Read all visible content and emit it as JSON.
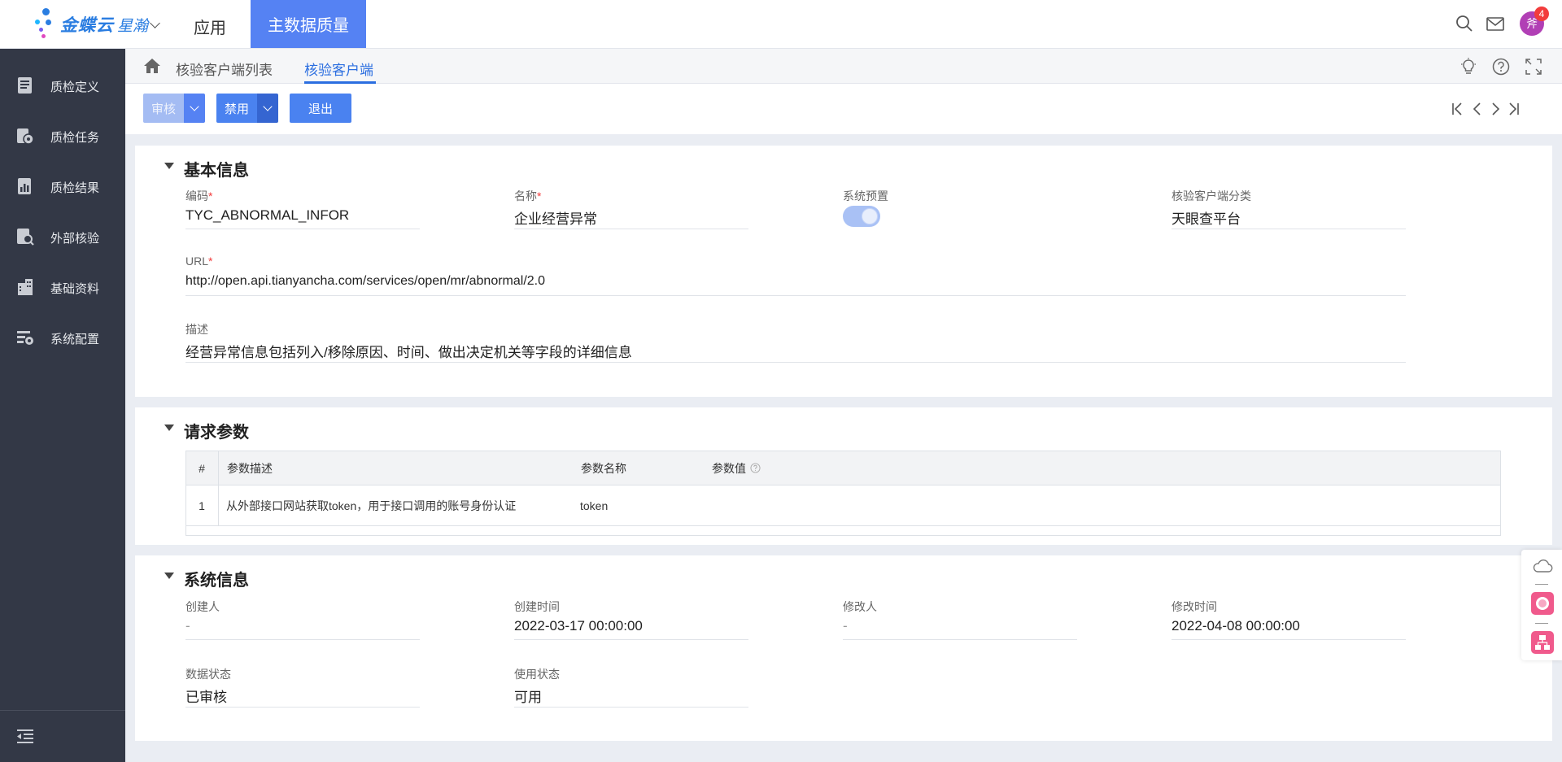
{
  "header": {
    "logo_text": "金蝶云",
    "logo_sub": "星瀚",
    "nav_app": "应用",
    "nav_active": "主数据质量",
    "notification_count": "4",
    "avatar_text": "斧"
  },
  "sidebar": {
    "items": [
      {
        "label": "质检定义",
        "icon": "book-icon"
      },
      {
        "label": "质检任务",
        "icon": "task-gear-icon"
      },
      {
        "label": "质检结果",
        "icon": "report-chart-icon"
      },
      {
        "label": "外部核验",
        "icon": "search-document-icon"
      },
      {
        "label": "基础资料",
        "icon": "building-icon"
      },
      {
        "label": "系统配置",
        "icon": "settings-list-icon"
      }
    ]
  },
  "breadcrumb": {
    "list": "核验客户端列表",
    "current": "核验客户端"
  },
  "toolbar": {
    "audit": "审核",
    "disable": "禁用",
    "exit": "退出"
  },
  "basic_info": {
    "title": "基本信息",
    "code_label": "编码",
    "code_value": "TYC_ABNORMAL_INFOR",
    "name_label": "名称",
    "name_value": "企业经营异常",
    "preset_label": "系统预置",
    "preset_on": true,
    "category_label": "核验客户端分类",
    "category_value": "天眼查平台",
    "url_label": "URL",
    "url_value": "http://open.api.tianyancha.com/services/open/mr/abnormal/2.0",
    "desc_label": "描述",
    "desc_value": "经营异常信息包括列入/移除原因、时间、做出决定机关等字段的详细信息"
  },
  "request_params": {
    "title": "请求参数",
    "columns": {
      "index": "#",
      "desc": "参数描述",
      "name": "参数名称",
      "value": "参数值"
    },
    "rows": [
      {
        "index": "1",
        "desc": "从外部接口网站获取token，用于接口调用的账号身份认证",
        "name": "token",
        "value": ""
      }
    ]
  },
  "system_info": {
    "title": "系统信息",
    "creator_label": "创建人",
    "creator_value": "-",
    "created_label": "创建时间",
    "created_value": "2022-03-17 00:00:00",
    "modifier_label": "修改人",
    "modifier_value": "-",
    "modified_label": "修改时间",
    "modified_value": "2022-04-08 00:00:00",
    "data_status_label": "数据状态",
    "data_status_value": "已审核",
    "use_status_label": "使用状态",
    "use_status_value": "可用"
  },
  "colors": {
    "primary": "#5582f3",
    "sidebar": "#333846",
    "link": "#2b6ee0",
    "required": "#f23c3c"
  }
}
